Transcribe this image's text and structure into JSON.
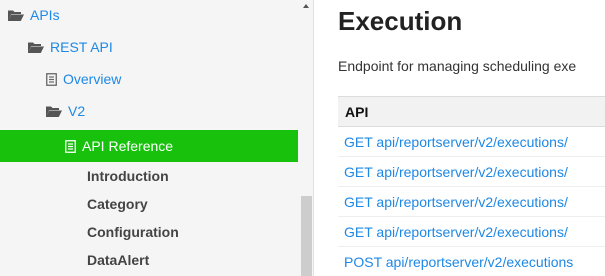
{
  "sidebar": {
    "items": [
      {
        "label": "APIs",
        "icon": "folder-open-icon"
      },
      {
        "label": "REST API",
        "icon": "folder-open-icon"
      },
      {
        "label": "Overview",
        "icon": "document-icon"
      },
      {
        "label": "V2",
        "icon": "folder-open-icon"
      },
      {
        "label": "API Reference",
        "icon": "document-icon",
        "active": true
      }
    ],
    "subitems": [
      "Introduction",
      "Category",
      "Configuration",
      "DataAlert"
    ]
  },
  "main": {
    "title": "Execution",
    "description": "Endpoint for managing scheduling exe",
    "table": {
      "header": "API",
      "rows": [
        "GET api/reportserver/v2/executions/",
        "GET api/reportserver/v2/executions/",
        "GET api/reportserver/v2/executions/",
        "GET api/reportserver/v2/executions/",
        "POST api/reportserver/v2/executions"
      ]
    }
  },
  "colors": {
    "accent": "#18c20c",
    "link": "#1e88e5",
    "sidebar_bg": "#f5f5f5"
  }
}
